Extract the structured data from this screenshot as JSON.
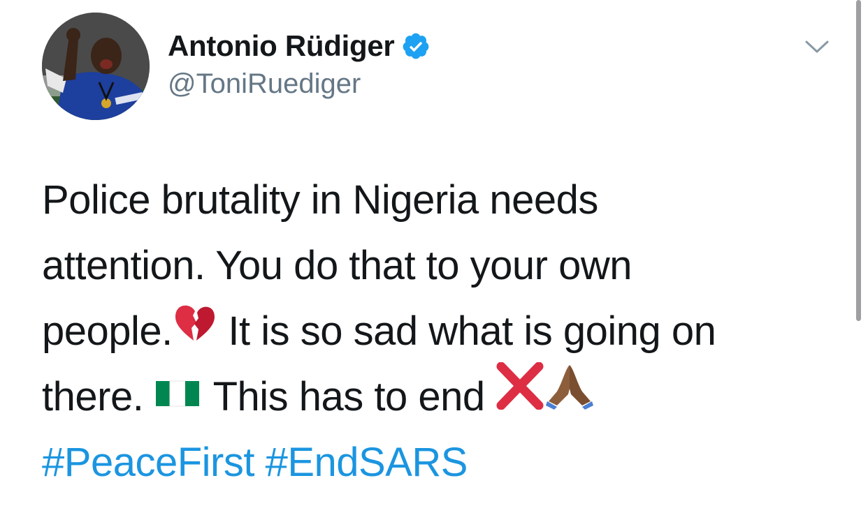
{
  "author": {
    "display_name": "Antonio Rüdiger",
    "handle": "@ToniRuediger",
    "verified": true
  },
  "tweet": {
    "lines": [
      "Police brutality in Nigeria needs",
      "attention. You do that to your own",
      "people.",
      "It is so sad what is going on",
      "there.",
      "This has to end"
    ],
    "hashtags": [
      "#PeaceFirst",
      "#EndSARS"
    ],
    "emojis": [
      "broken-heart-icon",
      "nigeria-flag-icon",
      "cross-mark-icon",
      "folded-hands-icon"
    ]
  },
  "colors": {
    "text": "#14171a",
    "secondary": "#657786",
    "link": "#1b95e0",
    "verified": "#1da1f2"
  }
}
